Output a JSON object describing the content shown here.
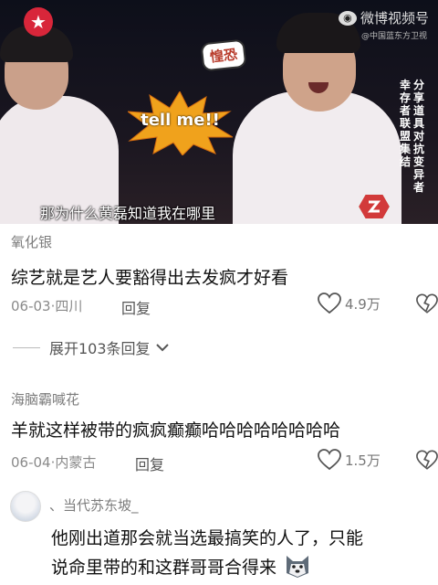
{
  "video": {
    "watermark_handle": "微博视频号",
    "watermark_sub": "@中国蓝东方卫视",
    "sticker_fear": "惶恐",
    "burst_text": "tell me!!",
    "vertical_caption_1": "幸存者联盟集结",
    "vertical_caption_2": "分享道具对抗变异者",
    "subtitle": "那为什么黄磊知道我在哪里"
  },
  "comments": [
    {
      "user": "氧化银",
      "text": "综艺就是艺人要豁得出去发疯才好看",
      "date": "06-03",
      "location": "四川",
      "reply_label": "回复",
      "likes": "4.9万"
    },
    {
      "user": "海脑霸喊花",
      "text": "羊就这样被带的疯疯癫癫哈哈哈哈哈哈哈哈",
      "date": "06-04",
      "location": "内蒙古",
      "reply_label": "回复",
      "likes": "1.5万"
    },
    {
      "user": "、当代苏东坡_",
      "text_line1": "他刚出道那会就当选最搞笑的人了，只能",
      "text_line2": "说命里带的和这群哥哥合得来"
    }
  ],
  "expand_replies": "展开103条回复",
  "colors": {
    "like_icon": "#555555",
    "tv_logo": "#d8263a"
  },
  "icons": [
    "heart-icon",
    "broken-heart-icon",
    "chevron-down-icon"
  ]
}
